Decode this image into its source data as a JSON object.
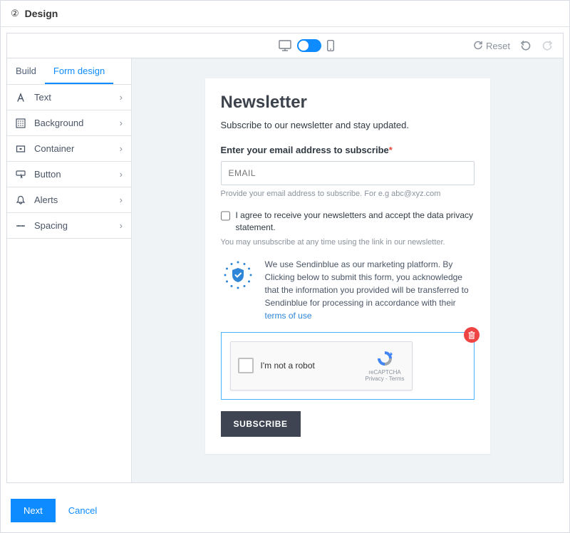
{
  "header": {
    "step": "②",
    "title": "Design"
  },
  "toolbar": {
    "reset": "Reset"
  },
  "tabs": {
    "build": "Build",
    "form_design": "Form design"
  },
  "sidebar": {
    "items": [
      {
        "label": "Text",
        "icon": "text-icon"
      },
      {
        "label": "Background",
        "icon": "background-icon"
      },
      {
        "label": "Container",
        "icon": "container-icon"
      },
      {
        "label": "Button",
        "icon": "button-icon"
      },
      {
        "label": "Alerts",
        "icon": "bell-icon"
      },
      {
        "label": "Spacing",
        "icon": "spacing-icon"
      }
    ]
  },
  "form": {
    "title": "Newsletter",
    "subtitle": "Subscribe to our newsletter and stay updated.",
    "email_label": "Enter your email address to subscribe",
    "email_placeholder": "EMAIL",
    "email_hint": "Provide your email address to subscribe. For e.g abc@xyz.com",
    "consent_text": "I agree to receive your newsletters and accept the data privacy statement.",
    "unsubscribe_hint": "You may unsubscribe at any time using the link in our newsletter.",
    "info_text_1": "We use Sendinblue as our marketing platform. By Clicking below to submit this form, you acknowledge that the information you provided will be transferred to Sendinblue for processing in accordance with their ",
    "info_link": "terms of use",
    "captcha_label": "I'm not a robot",
    "captcha_brand": "reCAPTCHA",
    "captcha_legal": "Privacy - Terms",
    "subscribe": "SUBSCRIBE"
  },
  "footer": {
    "next": "Next",
    "cancel": "Cancel"
  }
}
